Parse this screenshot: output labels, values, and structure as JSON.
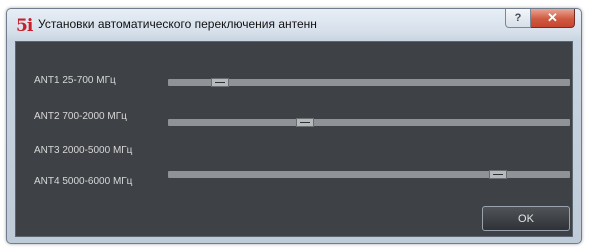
{
  "window": {
    "logo_text": "5i",
    "title": "Установки автоматического переключения антенн",
    "help_label": "?",
    "close_label": "✕"
  },
  "antennas": [
    {
      "label": "ANT1 25-700 МГц",
      "level": 0.13
    },
    {
      "label": "ANT2 700-2000 МГц",
      "level": 0.34
    },
    {
      "label": "ANT3 2000-5000 МГц",
      "level": null
    },
    {
      "label": "ANT4 5000-6000 МГц",
      "level": 0.82
    }
  ],
  "buttons": {
    "ok_label": "OK"
  },
  "colors": {
    "client_background": "#3e4145",
    "close_button": "#c64530",
    "logo": "#c8202a"
  }
}
